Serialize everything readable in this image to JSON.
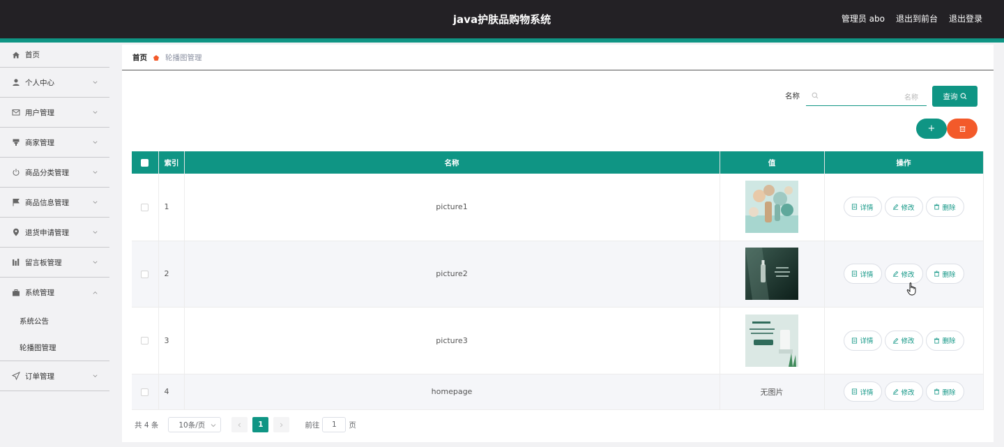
{
  "header": {
    "title": "java护肤品购物系统",
    "admin": "管理员 abo",
    "to_front": "退出到前台",
    "logout": "退出登录"
  },
  "sidebar": {
    "items": [
      {
        "label": "首页",
        "icon": "home-icon"
      },
      {
        "label": "个人中心",
        "icon": "user-icon"
      },
      {
        "label": "用户管理",
        "icon": "mail-icon"
      },
      {
        "label": "商家管理",
        "icon": "shop-icon"
      },
      {
        "label": "商品分类管理",
        "icon": "power-icon"
      },
      {
        "label": "商品信息管理",
        "icon": "flag-icon"
      },
      {
        "label": "退货申请管理",
        "icon": "location-icon"
      },
      {
        "label": "留言板管理",
        "icon": "chart-icon"
      },
      {
        "label": "系统管理",
        "icon": "briefcase-icon"
      },
      {
        "label": "订单管理",
        "icon": "send-icon"
      }
    ],
    "system_sub": [
      "系统公告",
      "轮播图管理"
    ]
  },
  "breadcrumb": {
    "home": "首页",
    "current": "轮播图管理"
  },
  "search": {
    "label": "名称",
    "placeholder": "名称",
    "button": "查询"
  },
  "toolbar": {
    "add": "+"
  },
  "table": {
    "headers": {
      "index": "索引",
      "name": "名称",
      "value": "值",
      "actions": "操作"
    },
    "rows": [
      {
        "index": "1",
        "name": "picture1",
        "value": ""
      },
      {
        "index": "2",
        "name": "picture2",
        "value": ""
      },
      {
        "index": "3",
        "name": "picture3",
        "value": ""
      },
      {
        "index": "4",
        "name": "homepage",
        "value": "无图片"
      }
    ],
    "actions": {
      "detail": "详情",
      "edit": "修改",
      "delete": "删除"
    }
  },
  "pagination": {
    "total": "共 4 条",
    "page_size": "10条/页",
    "current_page": "1",
    "goto_label": "前往",
    "goto_value": "1",
    "page_suffix": "页"
  },
  "colors": {
    "accent": "#0f9584",
    "danger": "#f35a2a",
    "header_bg": "#232125"
  }
}
